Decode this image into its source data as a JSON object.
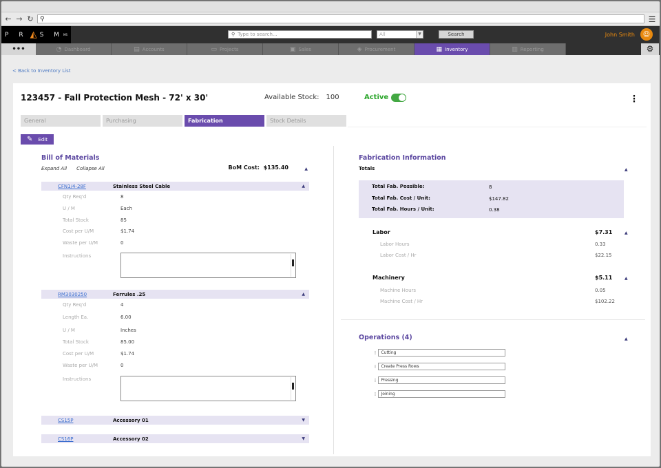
{
  "browser": {
    "back_icon": "←",
    "forward_icon": "→",
    "reload_icon": "↻",
    "search_icon": "⚲",
    "menu_icon": "☰"
  },
  "header": {
    "logo": {
      "left": "P R",
      "tri": "◭",
      "right": "S M",
      "sup": "MS"
    },
    "search_placeholder": "Type to search...",
    "filter_value": "All",
    "search_button": "Search",
    "user_name": "John Smith"
  },
  "nav": {
    "more": "•••",
    "tabs": [
      {
        "label": "Dashboard",
        "icon": "◔"
      },
      {
        "label": "Accounts",
        "icon": "▤"
      },
      {
        "label": "Projects",
        "icon": "▭"
      },
      {
        "label": "Sales",
        "icon": "▣"
      },
      {
        "label": "Procurement",
        "icon": "◈"
      },
      {
        "label": "Inventory",
        "icon": "▦"
      },
      {
        "label": "Reporting",
        "icon": "▥"
      }
    ],
    "active": "Inventory",
    "gear_icon": "⚙"
  },
  "back_link": "< Back to Inventory List",
  "item": {
    "title": "123457 - Fall Protection Mesh - 72' x 30'",
    "available_stock_label": "Available Stock:",
    "available_stock_value": "100",
    "status_label": "Active",
    "status_on": true
  },
  "subtabs": [
    "General",
    "Purchasing",
    "Fabrication",
    "Stock Details"
  ],
  "active_subtab": "Fabrication",
  "edit_label": "Edit",
  "bom": {
    "title": "Bill of Materials",
    "expand_all": "Expand All",
    "collapse_all": "Collapse All",
    "cost_label": "BoM Cost:",
    "cost_value": "$135.40",
    "items": [
      {
        "code": "CFN1/4-28F",
        "name": "Stainless Steel Cable",
        "expanded": true,
        "fields": [
          {
            "label": "Qty Req'd",
            "value": "8"
          },
          {
            "label": "U / M",
            "value": "Each"
          },
          {
            "label": "Total Stock",
            "value": "85"
          },
          {
            "label": "Cost per U/M",
            "value": "$1.74"
          },
          {
            "label": "Waste per U/M",
            "value": "0"
          }
        ],
        "instructions_label": "Instructions"
      },
      {
        "code": "RM3030250",
        "name": "Ferrules .25",
        "expanded": true,
        "fields": [
          {
            "label": "Qty Req'd",
            "value": "4"
          },
          {
            "label": "Length Ea.",
            "value": "6.00"
          },
          {
            "label": "U / M",
            "value": "Inches"
          },
          {
            "label": "Total Stock",
            "value": "85.00"
          },
          {
            "label": "Cost per U/M",
            "value": "$1.74"
          },
          {
            "label": "Waste per U/M",
            "value": "0"
          }
        ],
        "instructions_label": "Instructions"
      },
      {
        "code": "CS15P",
        "name": "Accessory 01",
        "expanded": false
      },
      {
        "code": "CS16P",
        "name": "Accessory 02",
        "expanded": false
      }
    ]
  },
  "fabrication": {
    "title": "Fabrication Information",
    "totals_label": "Totals",
    "totals": [
      {
        "label": "Total Fab. Possible:",
        "value": "8"
      },
      {
        "label": "Total Fab. Cost / Unit:",
        "value": "$147.82"
      },
      {
        "label": "Total Fab. Hours / Unit:",
        "value": "0.38"
      }
    ],
    "labor": {
      "label": "Labor",
      "value": "$7.31",
      "rows": [
        {
          "label": "Labor Hours",
          "value": "0.33"
        },
        {
          "label": "Labor Cost / Hr",
          "value": "$22.15"
        }
      ]
    },
    "machinery": {
      "label": "Machinery",
      "value": "$5.11",
      "rows": [
        {
          "label": "Machine Hours",
          "value": "0.05"
        },
        {
          "label": "Machine Cost / Hr",
          "value": "$102.22"
        }
      ]
    }
  },
  "operations": {
    "title": "Operations (4)",
    "items": [
      "Cutting",
      "Create Press Rows",
      "Pressing",
      "Joining"
    ]
  },
  "glyphs": {
    "caret_up": "▲",
    "caret_down": "▼",
    "pencil": "✎",
    "grip": "⁞⁞",
    "kebab": "⋮",
    "user": "☺"
  }
}
